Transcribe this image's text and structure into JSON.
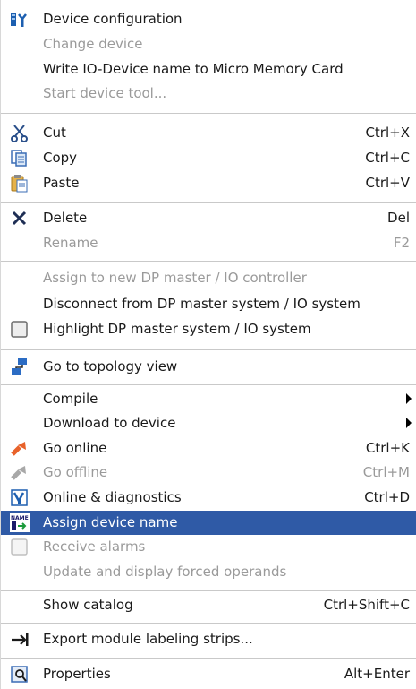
{
  "menu": {
    "device_configuration": {
      "label": "Device configuration",
      "icon": "device-config-icon"
    },
    "change_device": {
      "label": "Change device"
    },
    "write_io_device_name": {
      "label": "Write IO-Device name to Micro Memory Card"
    },
    "start_device_tool": {
      "label": "Start device tool..."
    },
    "cut": {
      "label": "Cut",
      "shortcut": "Ctrl+X",
      "icon": "scissors-icon"
    },
    "copy": {
      "label": "Copy",
      "shortcut": "Ctrl+C",
      "icon": "copy-icon"
    },
    "paste": {
      "label": "Paste",
      "shortcut": "Ctrl+V",
      "icon": "paste-icon"
    },
    "delete": {
      "label": "Delete",
      "shortcut": "Del",
      "icon": "delete-x-icon"
    },
    "rename": {
      "label": "Rename",
      "shortcut": "F2"
    },
    "assign_to_master": {
      "label": "Assign to new DP master / IO controller"
    },
    "disconnect_master": {
      "label": "Disconnect from DP master system / IO system"
    },
    "highlight_master": {
      "label": "Highlight DP master system / IO system",
      "icon": "checkbox-icon"
    },
    "go_topology": {
      "label": "Go to topology view",
      "icon": "topology-icon"
    },
    "compile": {
      "label": "Compile"
    },
    "download": {
      "label": "Download to device"
    },
    "go_online": {
      "label": "Go online",
      "shortcut": "Ctrl+K",
      "icon": "go-online-icon"
    },
    "go_offline": {
      "label": "Go offline",
      "shortcut": "Ctrl+M",
      "icon": "go-offline-icon"
    },
    "online_diagnostics": {
      "label": "Online & diagnostics",
      "shortcut": "Ctrl+D",
      "icon": "diagnostics-icon"
    },
    "assign_device_name": {
      "label": "Assign device name",
      "icon": "name-assign-icon"
    },
    "receive_alarms": {
      "label": "Receive alarms",
      "icon": "checkbox-icon"
    },
    "update_forced": {
      "label": "Update and display forced operands"
    },
    "show_catalog": {
      "label": "Show catalog",
      "shortcut": "Ctrl+Shift+C"
    },
    "export_labels": {
      "label": "Export module labeling strips...",
      "icon": "export-arrow-icon"
    },
    "properties": {
      "label": "Properties",
      "shortcut": "Alt+Enter",
      "icon": "properties-icon"
    }
  },
  "colors": {
    "highlight": "#2f5aa6",
    "disabled_text": "#9a9a9a",
    "separator": "#c9c9c9"
  }
}
